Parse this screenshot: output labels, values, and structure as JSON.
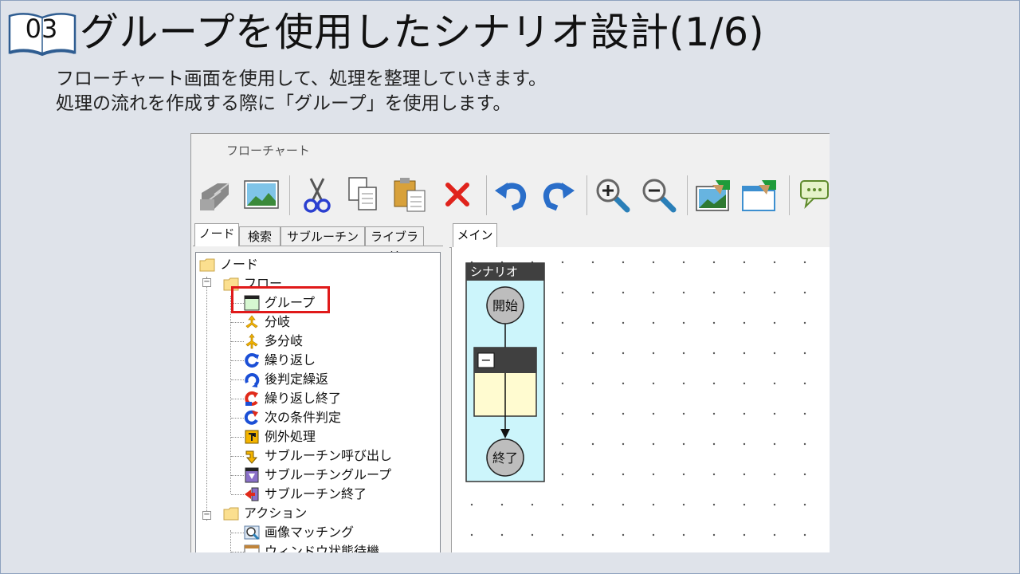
{
  "slide": {
    "number": "03",
    "title": "グループを使用したシナリオ設計(1/6)",
    "subtitle_line1": "フローチャート画面を使用して、処理を整理していきます。",
    "subtitle_line2": "処理の流れを作成する際に「グループ」を使用します。"
  },
  "app": {
    "title": "フローチャート",
    "toolbar": [
      "properties-icon",
      "image-icon",
      "cut-icon",
      "copy-icon",
      "paste-icon",
      "delete-icon",
      "undo-icon",
      "redo-icon",
      "zoom-in-icon",
      "zoom-out-icon",
      "image-capture-icon",
      "window-capture-icon",
      "comment-icon"
    ],
    "left_tabs": [
      "ノード",
      "検索",
      "サブルーチン",
      "ライブラリ"
    ],
    "tree": {
      "root": "ノード",
      "flow": "フロー",
      "flow_items": [
        "グループ",
        "分岐",
        "多分岐",
        "繰り返し",
        "後判定繰返",
        "繰り返し終了",
        "次の条件判定",
        "例外処理",
        "サブルーチン呼び出し",
        "サブルーチングループ",
        "サブルーチン終了"
      ],
      "action": "アクション",
      "action_items": [
        "画像マッチング",
        "ウィンドウ状態待機"
      ]
    },
    "right_tab": "メイン",
    "scenario": {
      "label": "シナリオ",
      "start": "開始",
      "end": "終了",
      "group_toggle": "−"
    },
    "colors": {
      "highlight": "#e01a1a",
      "scenario_bg": "#ccf5fb",
      "group_bg": "#fffbd0",
      "header_bg": "#404040"
    }
  }
}
